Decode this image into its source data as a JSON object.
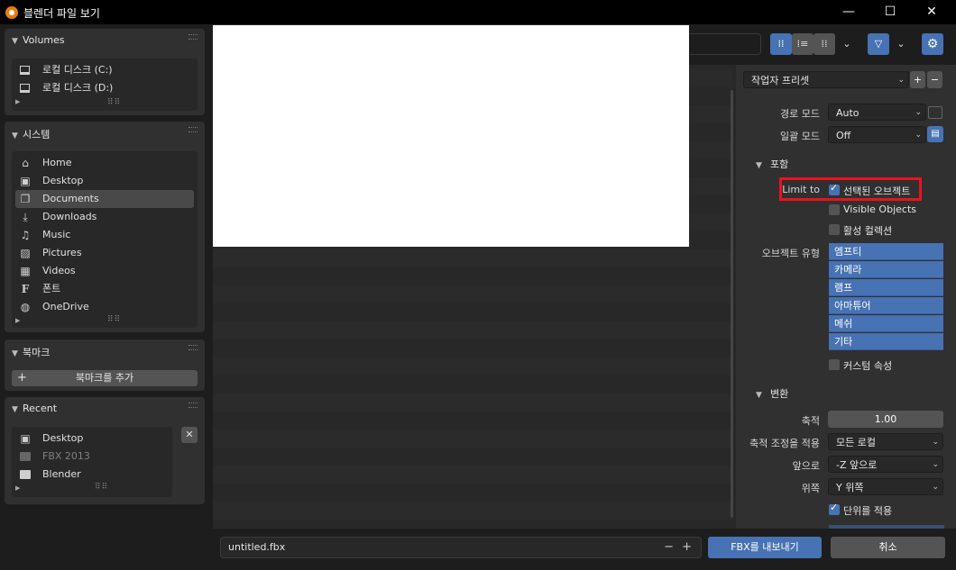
{
  "window": {
    "title": "블렌더 파일 보기",
    "minimize": "—",
    "maximize": "☐",
    "close": "✕"
  },
  "sidebar": {
    "volumes": {
      "header": "Volumes",
      "items": [
        {
          "label": "로컬 디스크 (C:)",
          "icon": "drive-icon"
        },
        {
          "label": "로컬 디스크 (D:)",
          "icon": "drive-icon"
        }
      ]
    },
    "system": {
      "header": "시스템",
      "items": [
        {
          "label": "Home",
          "icon": "home-icon",
          "glyph": "⌂"
        },
        {
          "label": "Desktop",
          "icon": "desktop-icon",
          "glyph": "▣"
        },
        {
          "label": "Documents",
          "icon": "documents-icon",
          "glyph": "❐"
        },
        {
          "label": "Downloads",
          "icon": "download-icon",
          "glyph": "⤓"
        },
        {
          "label": "Music",
          "icon": "music-icon",
          "glyph": "♫"
        },
        {
          "label": "Pictures",
          "icon": "picture-icon",
          "glyph": "▨"
        },
        {
          "label": "Videos",
          "icon": "video-icon",
          "glyph": "▦"
        },
        {
          "label": "폰트",
          "icon": "font-icon",
          "glyph": "F"
        },
        {
          "label": "OneDrive",
          "icon": "globe-icon",
          "glyph": "◍"
        }
      ],
      "selected": "Documents"
    },
    "bookmarks": {
      "header": "북마크",
      "add_label": "북마크를 추가",
      "add_glyph": "+"
    },
    "recent": {
      "header": "Recent",
      "remove_glyph": "✕",
      "items": [
        {
          "label": "Desktop",
          "icon": "desktop-icon",
          "glyph": "▣"
        },
        {
          "label": "FBX 2013",
          "icon": "folder-icon"
        },
        {
          "label": "Blender",
          "icon": "folder-icon"
        }
      ]
    }
  },
  "toolbar": {
    "view_vertical": "⁞⁞",
    "view_horizontal": "⁞≡",
    "view_thumbnails": "⁞⁞",
    "view_dropdown": "⌄",
    "filter_icon": "▽",
    "filter_dropdown": "⌄",
    "settings_icon": "⚙"
  },
  "options": {
    "operator_presets": "작업자 프리셋",
    "preset_add": "+",
    "preset_remove": "−",
    "path_mode": {
      "label": "경로 모드",
      "value": "Auto"
    },
    "batch_mode": {
      "label": "일괄 모드",
      "value": "Off"
    },
    "include": {
      "header": "포함",
      "limit_to_label": "Limit to",
      "selected_objects": {
        "label": "선택된 오브젝트",
        "checked": true
      },
      "visible_objects": {
        "label": "Visible Objects",
        "checked": false
      },
      "active_collection": {
        "label": "활성 컬렉션",
        "checked": false
      },
      "object_types_label": "오브젝트 유형",
      "object_types": [
        "엠프티",
        "카메라",
        "램프",
        "아마튜어",
        "메쉬",
        "기타"
      ],
      "custom_properties": {
        "label": "커스텀 속성",
        "checked": false
      }
    },
    "transform": {
      "header": "변환",
      "scale": {
        "label": "축적",
        "value": "1.00"
      },
      "apply_scaling": {
        "label": "축적 조정을 적용",
        "value": "모든 로컬"
      },
      "forward": {
        "label": "앞으로",
        "value": "-Z 앞으로"
      },
      "up": {
        "label": "위쪽",
        "value": "Y 위쪽"
      },
      "apply_unit": {
        "label": "단위를 적용",
        "checked": true
      }
    }
  },
  "footer": {
    "filename": "untitled.fbx",
    "decrement": "−",
    "increment": "+",
    "export_label": "FBX를 내보내기",
    "cancel_label": "취소"
  },
  "colors": {
    "accent": "#4772b3",
    "highlight_box": "#e8141e"
  }
}
